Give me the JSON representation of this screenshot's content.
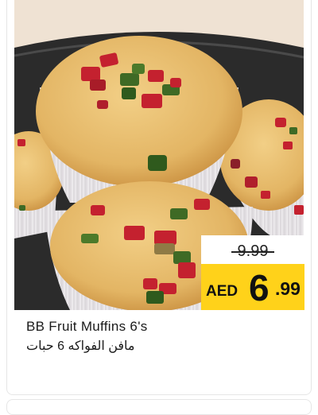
{
  "product": {
    "name": "BB Fruit Muffins 6's",
    "name_ar": "مافن الفواكه 6 حبات",
    "image_alt": "fruit-muffins-photo"
  },
  "price": {
    "old": "9.99",
    "currency": "AED",
    "whole": "6",
    "fraction": ".99"
  },
  "colors": {
    "price_badge": "#ffd21a",
    "muffin_crust": "#e3b564",
    "liner": "#ece9ec",
    "tray": "#2b2b2b",
    "candied_red": "#c4212f",
    "candied_green": "#3f6a25"
  }
}
